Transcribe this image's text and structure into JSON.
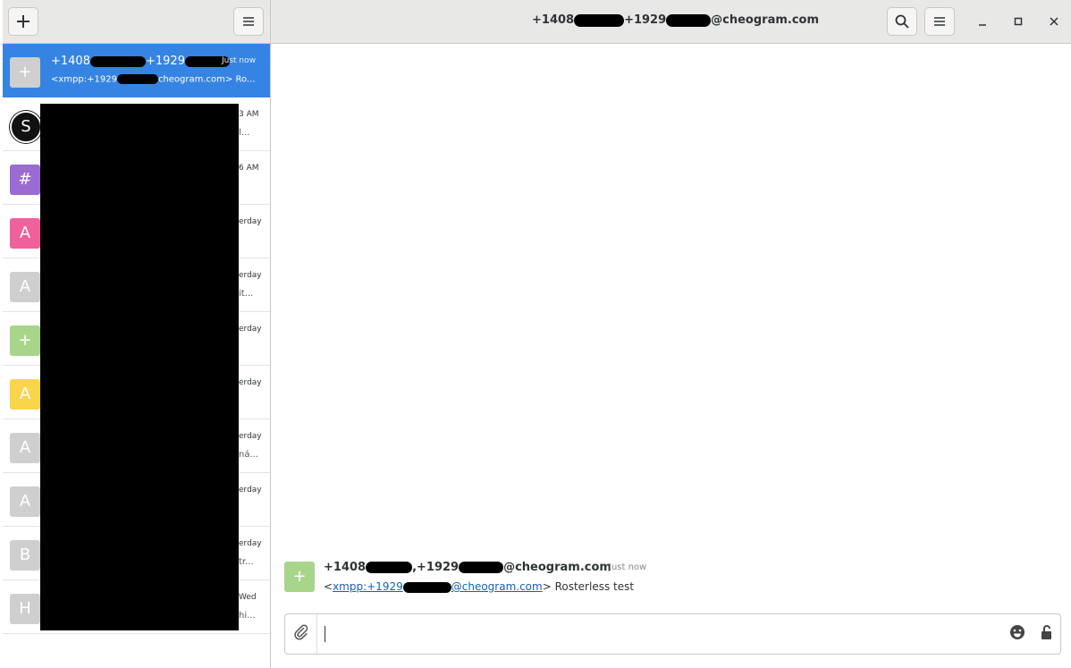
{
  "header": {
    "title_prefix": "+1408",
    "title_mid": "+1929",
    "title_suffix": "@cheogram.com",
    "icons": [
      "add-icon",
      "menu-icon",
      "search-icon",
      "menu-icon",
      "minimize-icon",
      "maximize-icon",
      "close-icon"
    ]
  },
  "sidebar": {
    "active": {
      "avatar": "+",
      "avatar_color": "#cfcfcf",
      "name_prefix": "+1408",
      "name_mid": "+1929",
      "time": "Just now",
      "preview_prefix": "<xmpp:+1929",
      "preview_suffix": "cheogram.com> Ro..."
    },
    "items": [
      {
        "avatar": "S",
        "color": "#111111",
        "time": "3 AM",
        "preview": "l..."
      },
      {
        "avatar": "#",
        "color": "#9a6bd0",
        "time": "6 AM",
        "preview": ""
      },
      {
        "avatar": "A",
        "color": "#f0609a",
        "time": "erday",
        "preview": ""
      },
      {
        "avatar": "A",
        "color": "#cfcfcf",
        "time": "erday",
        "preview": "it..."
      },
      {
        "avatar": "+",
        "color": "#a7d58a",
        "time": "erday",
        "preview": ""
      },
      {
        "avatar": "A",
        "color": "#f9d54a",
        "time": "erday",
        "preview": ""
      },
      {
        "avatar": "A",
        "color": "#cfcfcf",
        "time": "erday",
        "preview": "ná..."
      },
      {
        "avatar": "A",
        "color": "#cfcfcf",
        "time": "erday",
        "preview": ""
      },
      {
        "avatar": "B",
        "color": "#cfcfcf",
        "time": "erday",
        "preview": "tr..."
      },
      {
        "avatar": "H",
        "color": "#cfcfcf",
        "time": "Wed",
        "preview": "hi..."
      }
    ]
  },
  "message": {
    "avatar": "+",
    "sender_prefix": "+1408",
    "sender_mid": ",+1929",
    "sender_suffix": "@cheogram.com",
    "time": "Just now",
    "body_open": "<",
    "link_prefix": "xmpp:+1929",
    "link_suffix": "@cheogram.com",
    "body_rest": "> Rosterless test"
  },
  "composer": {
    "value": "",
    "placeholder": ""
  },
  "colors": {
    "accent": "#3584e4",
    "header_bg": "#e8e8e7",
    "link": "#1a5fb4"
  }
}
